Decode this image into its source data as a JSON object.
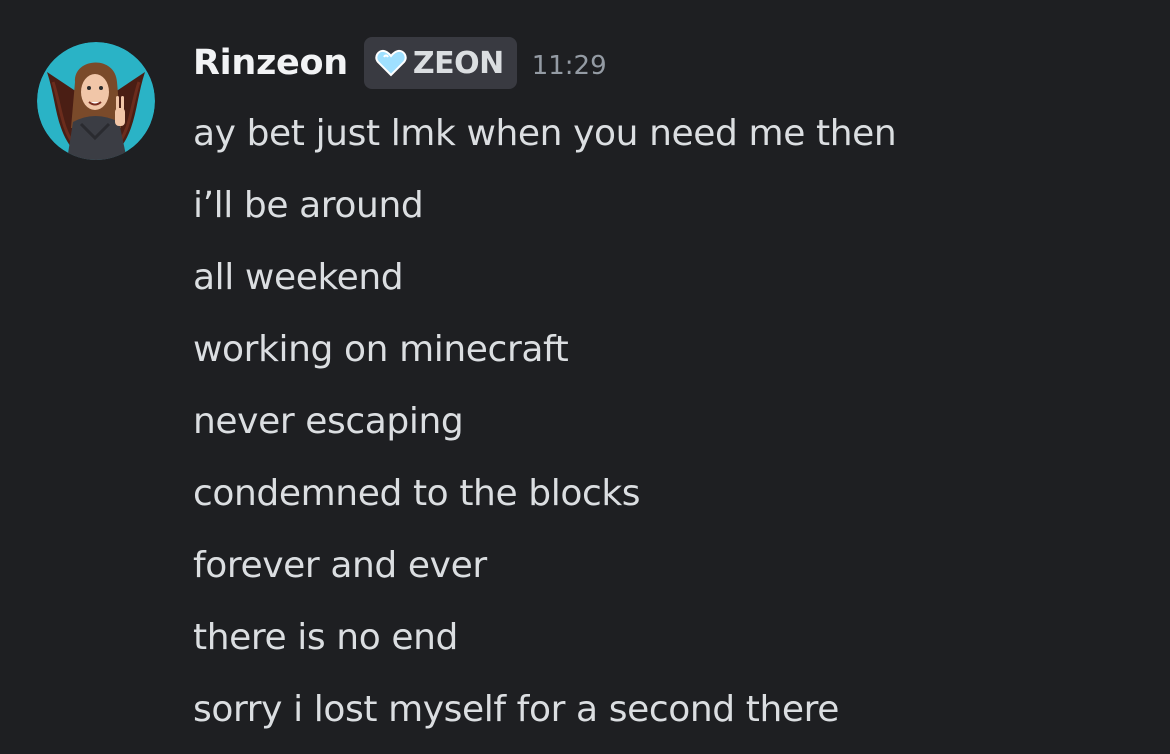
{
  "message": {
    "author": "Rinzeon",
    "tag": {
      "icon": "heart-icon",
      "label": "ZEON",
      "icon_color": "#9fe0ff"
    },
    "timestamp": "11:29",
    "lines": [
      "ay bet just lmk when you need me then",
      "i’ll be around",
      "all weekend",
      "working on minecraft",
      "never escaping",
      "condemned to the blocks",
      "forever and ever",
      "there is no end",
      "sorry i lost myself for a second there"
    ]
  },
  "colors": {
    "background": "#1e1f22",
    "avatar_ring": "#2ab3c6",
    "username": "#f2f3f5",
    "text": "#dbdee1",
    "muted": "#949ba4",
    "tag_bg": "#393a41"
  }
}
